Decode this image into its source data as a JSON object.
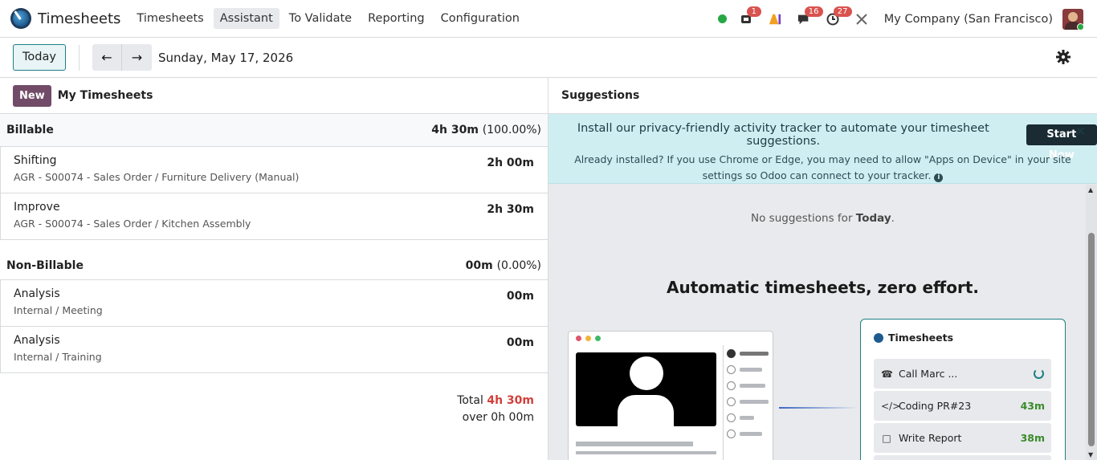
{
  "navbar": {
    "app_title": "Timesheets",
    "menu": [
      "Timesheets",
      "Assistant",
      "To Validate",
      "Reporting",
      "Configuration"
    ],
    "active_menu": "Assistant",
    "badges": {
      "phone": "1",
      "messages": "16",
      "activities": "27"
    },
    "company": "My Company (San Francisco)",
    "icons": [
      "phone-icon",
      "ai-icon",
      "chat-icon",
      "clock-icon",
      "tools-icon"
    ]
  },
  "control": {
    "today_label": "Today",
    "prev_icon": "arrow-left-icon",
    "next_icon": "arrow-right-icon",
    "date": "Sunday, May 17, 2026"
  },
  "timesheets": {
    "new_label": "New",
    "title": "My Timesheets",
    "billable": {
      "label": "Billable",
      "total": "4h 30m",
      "pct": "(100.00%)",
      "rows": [
        {
          "title": "Shifting",
          "subtitle": "AGR - S00074 - Sales Order / Furniture Delivery (Manual)",
          "hours": "2h 00m"
        },
        {
          "title": "Improve",
          "subtitle": "AGR - S00074 - Sales Order / Kitchen Assembly",
          "hours": "2h 30m"
        }
      ]
    },
    "non_billable": {
      "label": "Non-Billable",
      "total": "00m",
      "pct": "(0.00%)",
      "rows": [
        {
          "title": "Analysis",
          "subtitle": "Internal / Meeting",
          "hours": "00m"
        },
        {
          "title": "Analysis",
          "subtitle": "Internal / Training",
          "hours": "00m"
        }
      ]
    },
    "total_label": "Total",
    "total_value": "4h 30m",
    "over_label": "over 0h 00m"
  },
  "suggestions": {
    "title": "Suggestions",
    "alert_main": "Install our privacy-friendly activity tracker to automate your timesheet suggestions.",
    "start_now": "Start Now",
    "alert_sub": "Already installed? If you use Chrome or Edge, you may need to allow \"Apps on Device\" in your site settings so Odoo can connect to your tracker.",
    "no_sug_prefix": "No suggestions for",
    "no_sug_day": "Today",
    "headline": "Automatic timesheets, zero effort.",
    "card_title": "Timesheets",
    "entries": [
      {
        "label": "Call Marc ...",
        "duration": ""
      },
      {
        "label": "Coding PR#23",
        "duration": "43m"
      },
      {
        "label": "Write Report",
        "duration": "38m"
      }
    ]
  },
  "colors": {
    "brand": "#714b67",
    "accent": "#1c7f86",
    "danger": "#d23f3a",
    "success": "#28a745"
  }
}
